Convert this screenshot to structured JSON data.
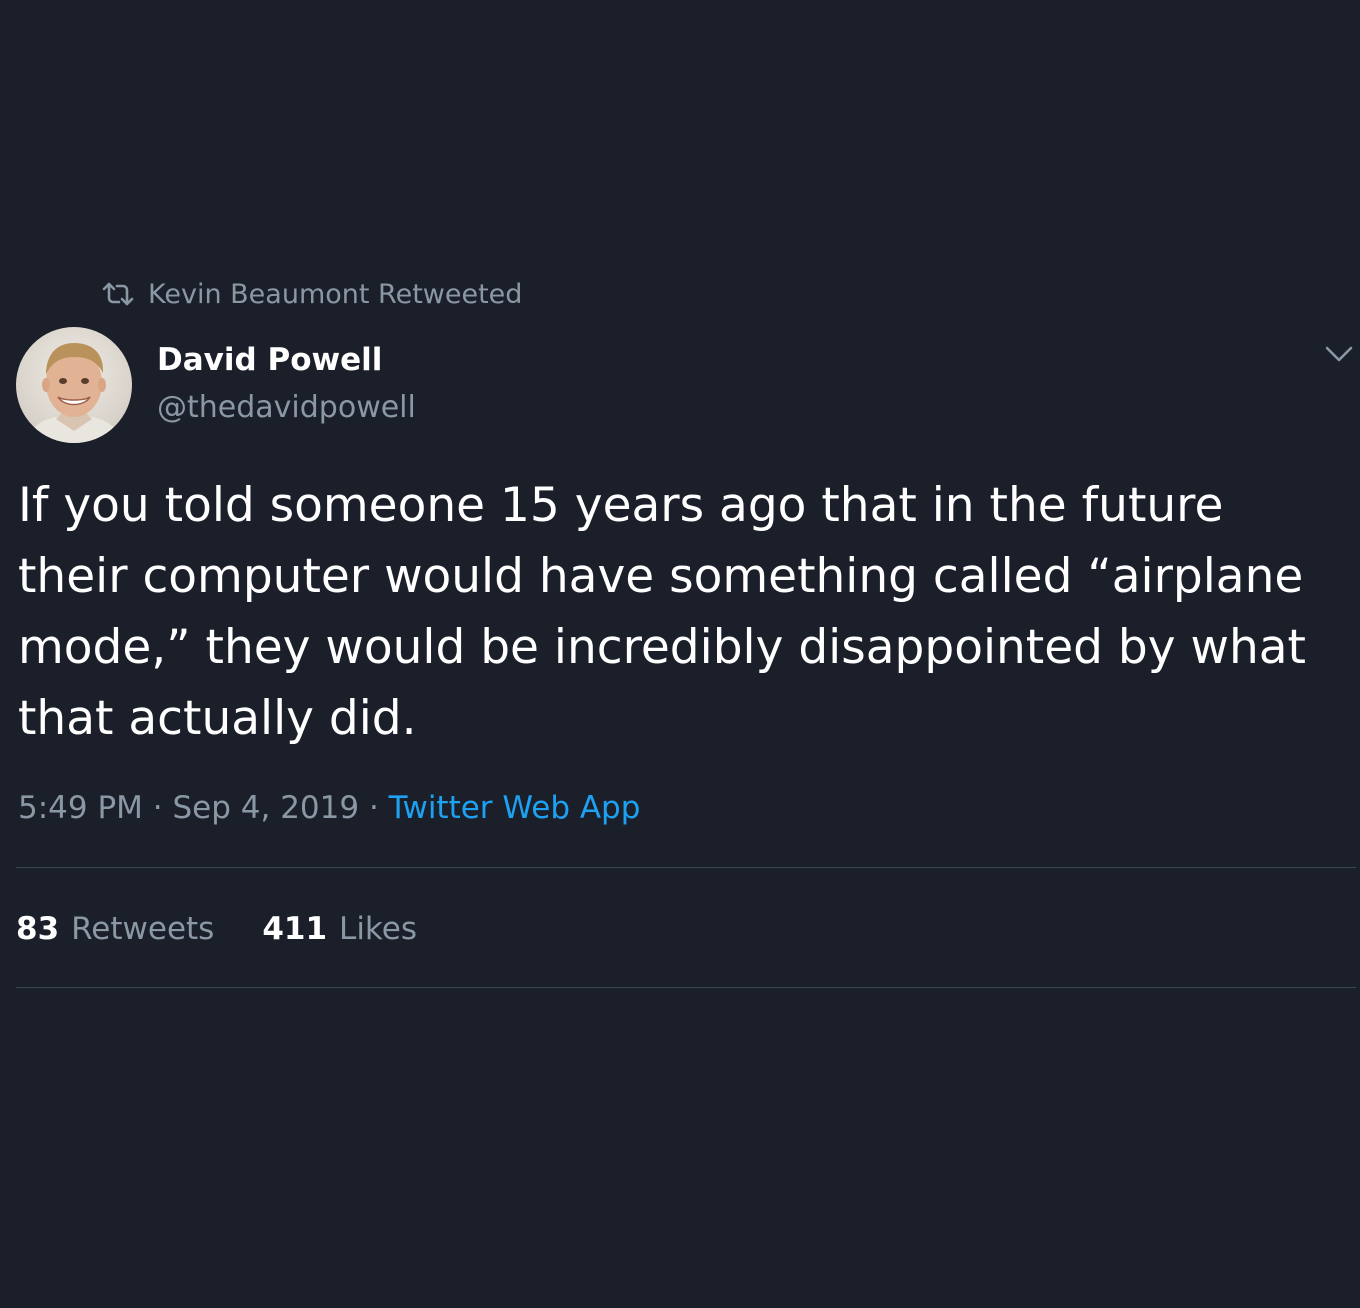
{
  "retweet_context": {
    "icon": "retweet-icon",
    "text": "Kevin Beaumont Retweeted"
  },
  "author": {
    "display_name": "David Powell",
    "handle": "@thedavidpowell",
    "avatar": "avatar-photo"
  },
  "menu": {
    "icon": "chevron-down-icon"
  },
  "tweet": {
    "lines": [
      "If you told someone 15 years ago that in the future",
      "their computer would have something called “airplane",
      "mode,” they would be incredibly disappointed by what",
      "that actually did."
    ]
  },
  "meta": {
    "time": "5:49 PM",
    "separator": " · ",
    "date": "Sep 4, 2019",
    "source": "Twitter Web App"
  },
  "stats": {
    "retweets_count": "83",
    "retweets_label": "Retweets",
    "likes_count": "411",
    "likes_label": "Likes"
  },
  "colors": {
    "background": "#1b1f2a",
    "primary_text": "#ffffff",
    "secondary_text": "#8a97a4",
    "link": "#1da1f2",
    "divider": "#3b4350"
  }
}
